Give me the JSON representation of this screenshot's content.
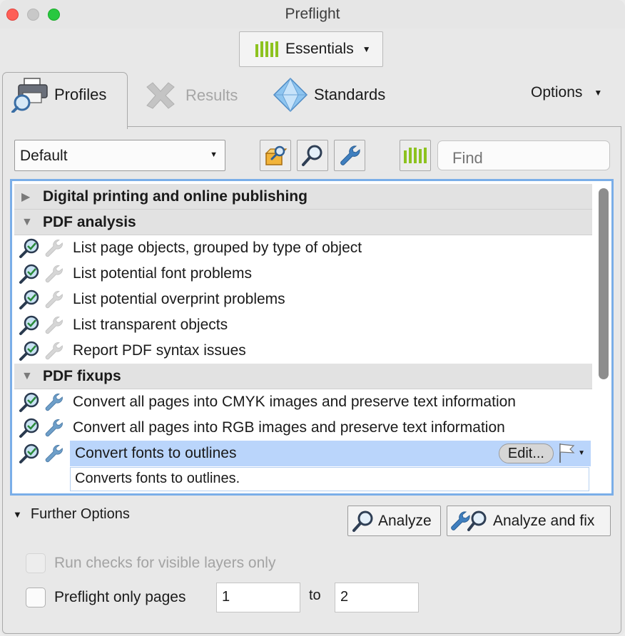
{
  "window": {
    "title": "Preflight"
  },
  "workspace": {
    "label": "Essentials",
    "icon": "library-icon"
  },
  "tabs": {
    "profiles": "Profiles",
    "results": "Results",
    "standards": "Standards",
    "options": "Options"
  },
  "toolbar": {
    "profile_set": "Default",
    "find_placeholder": "Find"
  },
  "list": {
    "groups": [
      {
        "label": "Digital printing and online publishing",
        "expanded": false
      },
      {
        "label": "PDF analysis",
        "expanded": true,
        "items": [
          "List page objects, grouped by type of object",
          "List potential font problems",
          "List potential overprint problems",
          "List transparent objects",
          "Report PDF syntax issues"
        ]
      },
      {
        "label": "PDF fixups",
        "expanded": true,
        "items": [
          "Convert all pages into CMYK images and preserve text information",
          "Convert all pages into RGB images and preserve text information",
          "Convert fonts to outlines"
        ]
      }
    ],
    "selected": {
      "label": "Convert fonts to outlines",
      "description": "Converts fonts to outlines.",
      "edit_label": "Edit..."
    }
  },
  "further_options": {
    "label": "Further Options"
  },
  "buttons": {
    "analyze": "Analyze",
    "analyze_fix": "Analyze and fix"
  },
  "options": {
    "visible_layers": {
      "label": "Run checks for visible layers only",
      "checked": false,
      "enabled": false
    },
    "only_pages": {
      "label": "Preflight only pages",
      "checked": false,
      "from": "1",
      "to_label": "to",
      "to": "2"
    }
  },
  "colors": {
    "accent_green": "#8dc21f",
    "selection": "#bad5fb",
    "focus_ring": "#7aaee8"
  }
}
